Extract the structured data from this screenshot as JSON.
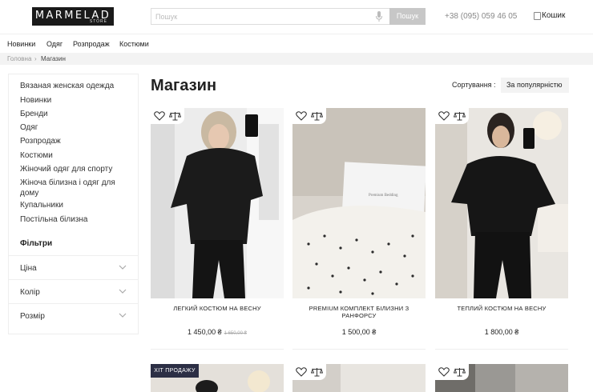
{
  "header": {
    "logo_text": "MARMELAD",
    "logo_sub": "STORE",
    "search_placeholder": "Пошук",
    "search_button": "Пошук",
    "phone": "+38 (095) 059 46 05",
    "cart_label": "Кошик"
  },
  "nav": {
    "items": [
      "Новинки",
      "Одяг",
      "Розпродаж",
      "Костюми"
    ]
  },
  "breadcrumb": {
    "home": "Головна",
    "separator": "›",
    "current": "Магазин"
  },
  "sidebar": {
    "categories": [
      "Вязаная женская одежда",
      "Новинки",
      "Бренди",
      "Одяг",
      "Розпродаж",
      "Костюми",
      "Жіночий одяг для спорту",
      "Жіноча білизна і одяг для дому",
      "Купальники",
      "Постільна білизна"
    ],
    "filters_title": "Фільтри",
    "filters": [
      "Ціна",
      "Колір",
      "Розмір"
    ]
  },
  "main": {
    "title": "Магазин",
    "sort_label": "Сортування :",
    "sort_value": "За популярністю"
  },
  "products": [
    {
      "name": "ЛЕГКИЙ КОСТЮМ НА ВЕСНУ",
      "price": "1 450,00 ₴",
      "old_price": "1 650,00 ₴"
    },
    {
      "name": "PREMIUM КОМПЛЕКТ БІЛИЗНИ З РАНФОРСУ",
      "price": "1 500,00 ₴",
      "old_price": ""
    },
    {
      "name": "ТЕПЛИЙ КОСТЮМ НА ВЕСНУ",
      "price": "1 800,00 ₴",
      "old_price": ""
    }
  ],
  "row2": {
    "badge": "ХІТ ПРОДАЖУ"
  },
  "icons": {
    "heart": "heart-icon",
    "compare": "scale-icon",
    "chevron": "chevron-down-icon",
    "mic": "mic-icon",
    "cart": "cart-icon"
  }
}
